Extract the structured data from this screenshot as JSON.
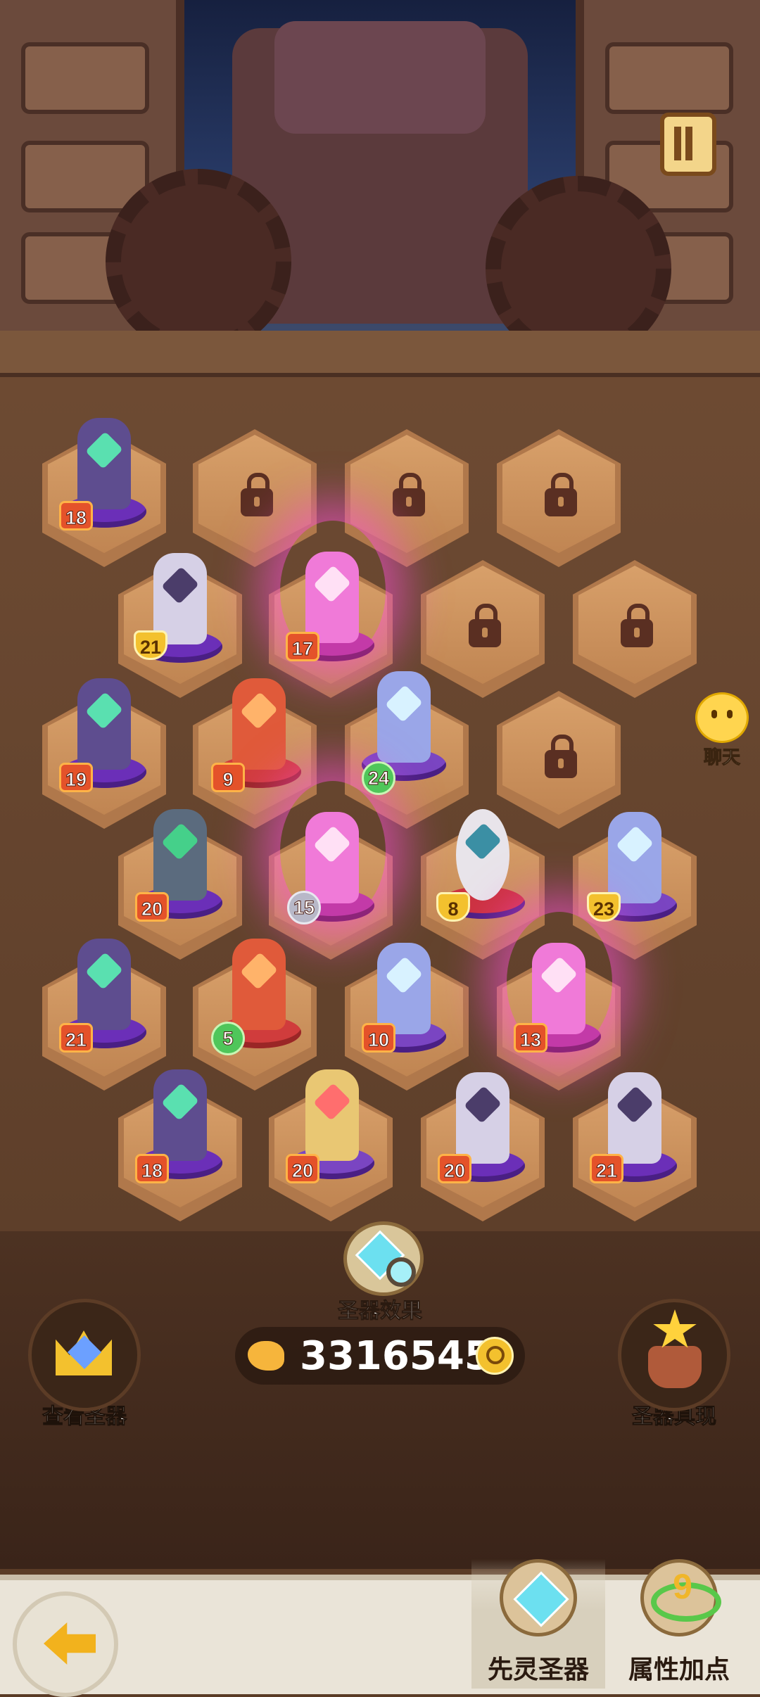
{
  "header": {
    "scroll_icon": "scroll-menu-icon"
  },
  "chat": {
    "label": "聊天",
    "icon": "chat-smiley-icon"
  },
  "relics": [
    {
      "level": "18",
      "badge": "orange"
    },
    {
      "level": "21",
      "badge": "yellow"
    },
    {
      "level": "17",
      "badge": "orange"
    },
    {
      "level": "19",
      "badge": "orange"
    },
    {
      "level": "9",
      "badge": "orange"
    },
    {
      "level": "24",
      "badge": "green"
    },
    {
      "level": "20",
      "badge": "orange"
    },
    {
      "level": "15",
      "badge": "gray"
    },
    {
      "level": "8",
      "badge": "yellow"
    },
    {
      "level": "23",
      "badge": "yellow"
    },
    {
      "level": "21",
      "badge": "orange"
    },
    {
      "level": "5",
      "badge": "green"
    },
    {
      "level": "10",
      "badge": "orange"
    },
    {
      "level": "13",
      "badge": "orange"
    },
    {
      "level": "18",
      "badge": "orange"
    },
    {
      "level": "20",
      "badge": "orange"
    },
    {
      "level": "20",
      "badge": "orange"
    },
    {
      "level": "21",
      "badge": "orange"
    }
  ],
  "locked_slots": 6,
  "effect": {
    "label": "圣器效果",
    "icon": "relic-effect-magnifier-icon"
  },
  "power": {
    "value": "3316545",
    "icon": "muscle-power-icon"
  },
  "buttons": {
    "view_relics": "查看圣器",
    "manifest_relic": "圣器具现"
  },
  "footer": {
    "back_icon": "back-arrow-icon",
    "tabs": [
      {
        "label": "先灵圣器",
        "icon": "relic-diamond-icon",
        "active": true
      },
      {
        "label": "属性加点",
        "icon": "attribute-points-icon",
        "active": false
      }
    ]
  },
  "colors": {
    "badge_orange": "#e4522a",
    "badge_yellow": "#f3c12e",
    "badge_green": "#4fc65a",
    "hex_tile": "#c08552",
    "glow_pink": "#ff50dc"
  }
}
